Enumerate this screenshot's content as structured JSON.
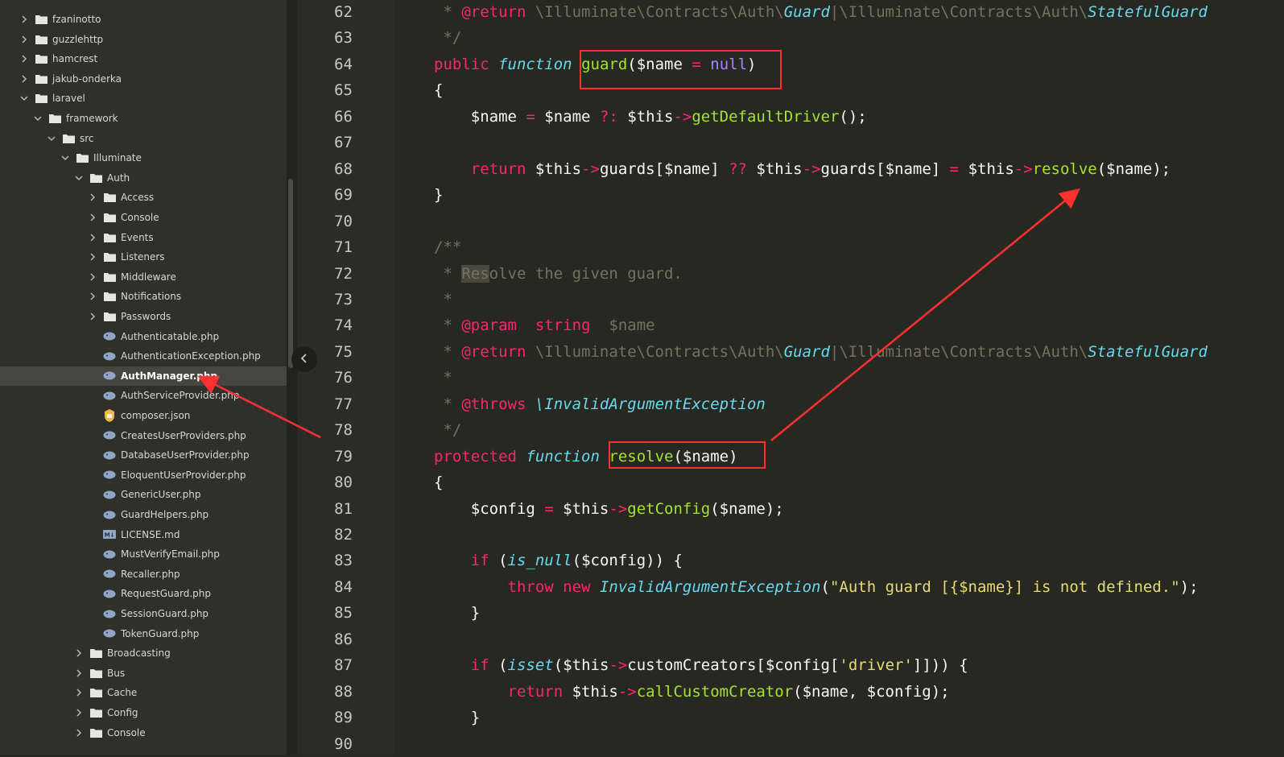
{
  "sidebar": {
    "items": [
      {
        "label": "fzaninotto",
        "type": "folder",
        "depth": 1,
        "expanded": false
      },
      {
        "label": "guzzlehttp",
        "type": "folder",
        "depth": 1,
        "expanded": false
      },
      {
        "label": "hamcrest",
        "type": "folder",
        "depth": 1,
        "expanded": false
      },
      {
        "label": "jakub-onderka",
        "type": "folder",
        "depth": 1,
        "expanded": false
      },
      {
        "label": "laravel",
        "type": "folder",
        "depth": 1,
        "expanded": true
      },
      {
        "label": "framework",
        "type": "folder",
        "depth": 2,
        "expanded": true
      },
      {
        "label": "src",
        "type": "folder",
        "depth": 3,
        "expanded": true
      },
      {
        "label": "Illuminate",
        "type": "folder",
        "depth": 4,
        "expanded": true
      },
      {
        "label": "Auth",
        "type": "folder",
        "depth": 5,
        "expanded": true
      },
      {
        "label": "Access",
        "type": "folder",
        "depth": 6,
        "expanded": false
      },
      {
        "label": "Console",
        "type": "folder",
        "depth": 6,
        "expanded": false
      },
      {
        "label": "Events",
        "type": "folder",
        "depth": 6,
        "expanded": false
      },
      {
        "label": "Listeners",
        "type": "folder",
        "depth": 6,
        "expanded": false
      },
      {
        "label": "Middleware",
        "type": "folder",
        "depth": 6,
        "expanded": false
      },
      {
        "label": "Notifications",
        "type": "folder",
        "depth": 6,
        "expanded": false
      },
      {
        "label": "Passwords",
        "type": "folder",
        "depth": 6,
        "expanded": false
      },
      {
        "label": "Authenticatable.php",
        "type": "php",
        "depth": 6
      },
      {
        "label": "AuthenticationException.php",
        "type": "php",
        "depth": 6
      },
      {
        "label": "AuthManager.php",
        "type": "php",
        "depth": 6,
        "selected": true
      },
      {
        "label": "AuthServiceProvider.php",
        "type": "php",
        "depth": 6
      },
      {
        "label": "composer.json",
        "type": "json",
        "depth": 6
      },
      {
        "label": "CreatesUserProviders.php",
        "type": "php",
        "depth": 6
      },
      {
        "label": "DatabaseUserProvider.php",
        "type": "php",
        "depth": 6
      },
      {
        "label": "EloquentUserProvider.php",
        "type": "php",
        "depth": 6
      },
      {
        "label": "GenericUser.php",
        "type": "php",
        "depth": 6
      },
      {
        "label": "GuardHelpers.php",
        "type": "php",
        "depth": 6
      },
      {
        "label": "LICENSE.md",
        "type": "md",
        "depth": 6
      },
      {
        "label": "MustVerifyEmail.php",
        "type": "php",
        "depth": 6
      },
      {
        "label": "Recaller.php",
        "type": "php",
        "depth": 6
      },
      {
        "label": "RequestGuard.php",
        "type": "php",
        "depth": 6
      },
      {
        "label": "SessionGuard.php",
        "type": "php",
        "depth": 6
      },
      {
        "label": "TokenGuard.php",
        "type": "php",
        "depth": 6
      },
      {
        "label": "Broadcasting",
        "type": "folder",
        "depth": 5,
        "expanded": false
      },
      {
        "label": "Bus",
        "type": "folder",
        "depth": 5,
        "expanded": false
      },
      {
        "label": "Cache",
        "type": "folder",
        "depth": 5,
        "expanded": false
      },
      {
        "label": "Config",
        "type": "folder",
        "depth": 5,
        "expanded": false
      },
      {
        "label": "Console",
        "type": "folder",
        "depth": 5,
        "expanded": false
      }
    ]
  },
  "collapse_icon": "chevron-left-icon",
  "editor": {
    "lines": [
      {
        "n": "62",
        "indent": 0,
        "tokens": [
          [
            "cm",
            " * "
          ],
          [
            "kw",
            "@return"
          ],
          [
            "cm",
            " \\Illuminate\\Contracts\\Auth\\"
          ],
          [
            "it",
            "Guard"
          ],
          [
            "cm",
            "|\\Illuminate\\Contracts\\Auth\\"
          ],
          [
            "it",
            "StatefulGuard"
          ]
        ]
      },
      {
        "n": "63",
        "indent": 0,
        "tokens": [
          [
            "cm",
            " */"
          ]
        ]
      },
      {
        "n": "64",
        "indent": 0,
        "tokens": [
          [
            "kw",
            "public"
          ],
          [
            "tx",
            " "
          ],
          [
            "it",
            "function"
          ],
          [
            "tx",
            " "
          ],
          [
            "fn",
            "guard"
          ],
          [
            "tx",
            "($name "
          ],
          [
            "kw",
            "="
          ],
          [
            "tx",
            " "
          ],
          [
            "pu",
            "null"
          ],
          [
            "tx",
            ")"
          ]
        ]
      },
      {
        "n": "65",
        "indent": 0,
        "tokens": [
          [
            "tx",
            "{"
          ]
        ]
      },
      {
        "n": "66",
        "indent": 1,
        "tokens": [
          [
            "tx",
            "$name "
          ],
          [
            "kw",
            "="
          ],
          [
            "tx",
            " $name "
          ],
          [
            "kw",
            "?:"
          ],
          [
            "tx",
            " $this"
          ],
          [
            "kw",
            "->"
          ],
          [
            "fn",
            "getDefaultDriver"
          ],
          [
            "tx",
            "();"
          ]
        ]
      },
      {
        "n": "67",
        "indent": 0,
        "tokens": []
      },
      {
        "n": "68",
        "indent": 1,
        "tokens": [
          [
            "kw",
            "return"
          ],
          [
            "tx",
            " $this"
          ],
          [
            "kw",
            "->"
          ],
          [
            "tx",
            "guards[$name] "
          ],
          [
            "kw",
            "??"
          ],
          [
            "tx",
            " $this"
          ],
          [
            "kw",
            "->"
          ],
          [
            "tx",
            "guards[$name] "
          ],
          [
            "kw",
            "="
          ],
          [
            "tx",
            " $this"
          ],
          [
            "kw",
            "->"
          ],
          [
            "fn",
            "resolve"
          ],
          [
            "tx",
            "($name);"
          ]
        ]
      },
      {
        "n": "69",
        "indent": 0,
        "tokens": [
          [
            "tx",
            "}"
          ]
        ]
      },
      {
        "n": "70",
        "indent": 0,
        "tokens": []
      },
      {
        "n": "71",
        "indent": 0,
        "tokens": [
          [
            "cm",
            "/**"
          ]
        ]
      },
      {
        "n": "72",
        "indent": 0,
        "tokens": [
          [
            "cm",
            " * "
          ],
          [
            "hl",
            "Res"
          ],
          [
            "cm",
            "olve the given guard."
          ]
        ]
      },
      {
        "n": "73",
        "indent": 0,
        "tokens": [
          [
            "cm",
            " *"
          ]
        ]
      },
      {
        "n": "74",
        "indent": 0,
        "tokens": [
          [
            "cm",
            " * "
          ],
          [
            "kw",
            "@param"
          ],
          [
            "tx",
            "  "
          ],
          [
            "kw",
            "string"
          ],
          [
            "cm",
            "  $name"
          ]
        ]
      },
      {
        "n": "75",
        "indent": 0,
        "tokens": [
          [
            "cm",
            " * "
          ],
          [
            "kw",
            "@return"
          ],
          [
            "cm",
            " \\Illuminate\\Contracts\\Auth\\"
          ],
          [
            "it",
            "Guard"
          ],
          [
            "cm",
            "|\\Illuminate\\Contracts\\Auth\\"
          ],
          [
            "it",
            "StatefulGuard"
          ]
        ]
      },
      {
        "n": "76",
        "indent": 0,
        "tokens": [
          [
            "cm",
            " *"
          ]
        ]
      },
      {
        "n": "77",
        "indent": 0,
        "tokens": [
          [
            "cm",
            " * "
          ],
          [
            "kw",
            "@throws"
          ],
          [
            "tx",
            " "
          ],
          [
            "it",
            "\\InvalidArgumentException"
          ]
        ]
      },
      {
        "n": "78",
        "indent": 0,
        "tokens": [
          [
            "cm",
            " */"
          ]
        ]
      },
      {
        "n": "79",
        "indent": 0,
        "tokens": [
          [
            "kw",
            "protected"
          ],
          [
            "tx",
            " "
          ],
          [
            "it",
            "function"
          ],
          [
            "tx",
            " "
          ],
          [
            "fn",
            "resolve"
          ],
          [
            "tx",
            "($name)"
          ]
        ]
      },
      {
        "n": "80",
        "indent": 0,
        "tokens": [
          [
            "tx",
            "{"
          ]
        ]
      },
      {
        "n": "81",
        "indent": 1,
        "tokens": [
          [
            "tx",
            "$config "
          ],
          [
            "kw",
            "="
          ],
          [
            "tx",
            " $this"
          ],
          [
            "kw",
            "->"
          ],
          [
            "fn",
            "getConfig"
          ],
          [
            "tx",
            "($name);"
          ]
        ]
      },
      {
        "n": "82",
        "indent": 0,
        "tokens": []
      },
      {
        "n": "83",
        "indent": 1,
        "tokens": [
          [
            "kw",
            "if"
          ],
          [
            "tx",
            " ("
          ],
          [
            "it",
            "is_null"
          ],
          [
            "tx",
            "($config)) {"
          ]
        ]
      },
      {
        "n": "84",
        "indent": 2,
        "tokens": [
          [
            "kw",
            "throw"
          ],
          [
            "tx",
            " "
          ],
          [
            "kw",
            "new"
          ],
          [
            "tx",
            " "
          ],
          [
            "it",
            "InvalidArgumentException"
          ],
          [
            "tx",
            "("
          ],
          [
            "st",
            "\"Auth guard [{$name}] is not defined.\""
          ],
          [
            "tx",
            ");"
          ]
        ]
      },
      {
        "n": "85",
        "indent": 1,
        "tokens": [
          [
            "tx",
            "}"
          ]
        ]
      },
      {
        "n": "86",
        "indent": 0,
        "tokens": []
      },
      {
        "n": "87",
        "indent": 1,
        "tokens": [
          [
            "kw",
            "if"
          ],
          [
            "tx",
            " ("
          ],
          [
            "it",
            "isset"
          ],
          [
            "tx",
            "($this"
          ],
          [
            "kw",
            "->"
          ],
          [
            "tx",
            "customCreators[$config["
          ],
          [
            "st",
            "'driver'"
          ],
          [
            "tx",
            "]])) {"
          ]
        ]
      },
      {
        "n": "88",
        "indent": 2,
        "tokens": [
          [
            "kw",
            "return"
          ],
          [
            "tx",
            " $this"
          ],
          [
            "kw",
            "->"
          ],
          [
            "fn",
            "callCustomCreator"
          ],
          [
            "tx",
            "($name, $config);"
          ]
        ]
      },
      {
        "n": "89",
        "indent": 1,
        "tokens": [
          [
            "tx",
            "}"
          ]
        ]
      },
      {
        "n": "90",
        "indent": 0,
        "tokens": []
      }
    ]
  },
  "colors": {
    "background": "#272822",
    "keyword": "#f92672",
    "function": "#a6e22e",
    "italic_type": "#66d9ef",
    "constant": "#ae81ff",
    "string": "#e6db74",
    "comment": "#75715e",
    "annotation": "#ff3030"
  }
}
